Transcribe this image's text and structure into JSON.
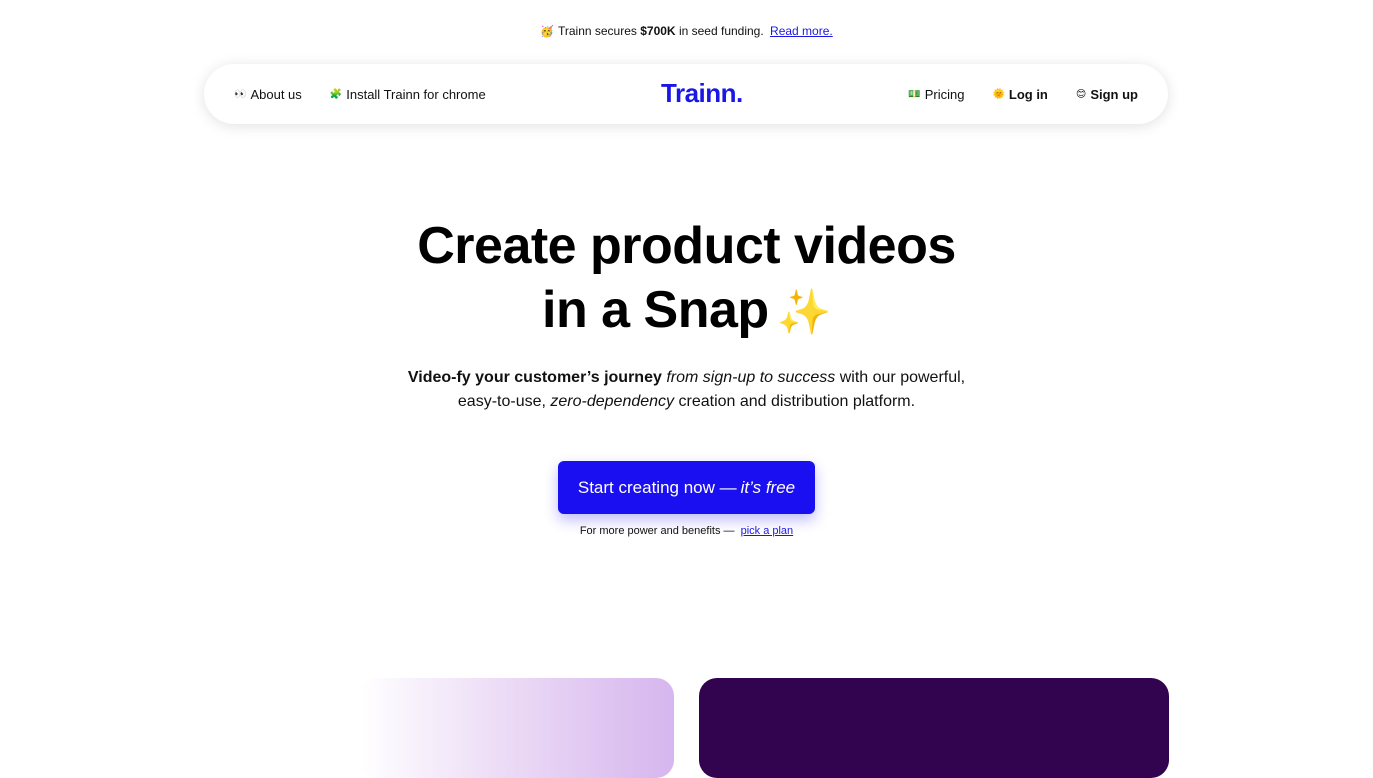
{
  "announcement": {
    "emoji": "🥳",
    "text_prefix": "Trainn secures",
    "amount": "$700K",
    "text_suffix": "in seed funding.",
    "link": "Read more."
  },
  "nav": {
    "about": {
      "icon": "eyes-icon",
      "emoji": "👀",
      "label": "About us"
    },
    "install": {
      "icon": "puzzle-icon",
      "emoji": "🧩",
      "label": "Install Trainn for chrome"
    },
    "logo": "Trainn.",
    "pricing": {
      "icon": "money-icon",
      "emoji": "💵",
      "label": "Pricing"
    },
    "login": {
      "icon": "sun-icon",
      "emoji": "🌞",
      "label": "Log in"
    },
    "signup": {
      "icon": "smile-icon",
      "emoji": "😊",
      "label": "Sign up"
    }
  },
  "hero": {
    "title_line1": "Create product videos",
    "title_line2": "in a Snap",
    "sparkle": "✨",
    "sub_bold": "Video-fy your customer’s journey",
    "sub_italic": "from sign-up to success",
    "sub_text1": "with our powerful,",
    "sub_text2": "easy-to-use,",
    "sub_italic2": "zero-dependency",
    "sub_text3": "creation and distribution platform."
  },
  "cta": {
    "label": "Start creating now —",
    "italic": "it’s free"
  },
  "more": {
    "text": "For more power and benefits —",
    "link": "pick a plan"
  },
  "colors": {
    "brand": "#1a17e6",
    "cta": "#1a0ff0",
    "dark_card": "#32034e",
    "light_card": "#d6b6ee"
  }
}
